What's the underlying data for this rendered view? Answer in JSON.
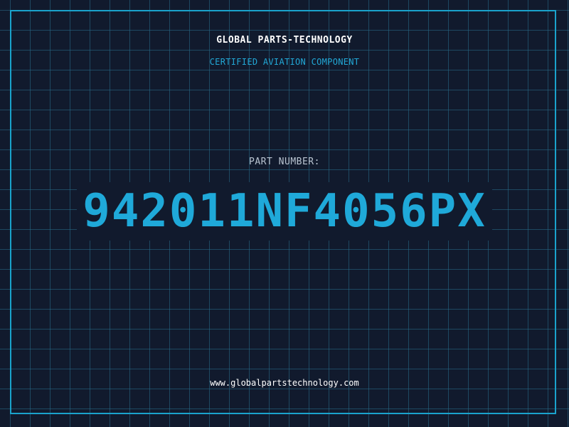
{
  "header": {
    "company": "GLOBAL PARTS-TECHNOLOGY",
    "subtitle": "CERTIFIED AVIATION COMPONENT"
  },
  "part": {
    "label": "PART NUMBER:",
    "number": "942011NF4056PX"
  },
  "footer": {
    "website": "www.globalpartstechnology.com"
  },
  "colors": {
    "background": "#111a2d",
    "grid": "#286e8c",
    "accent": "#1fa9d9",
    "text": "#ffffff",
    "label": "#b9c4d1"
  }
}
